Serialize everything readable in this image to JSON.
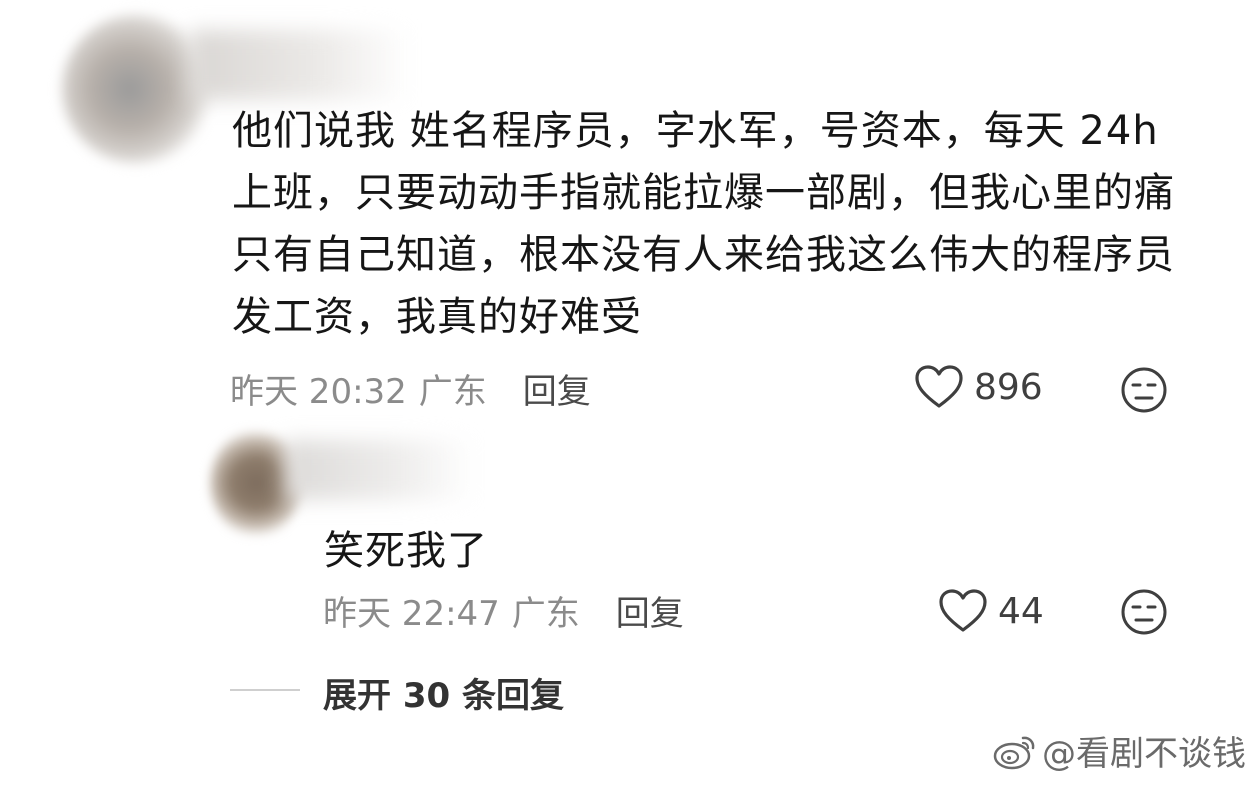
{
  "comment": {
    "text": "他们说我 姓名程序员，字水军，号资本，每天 24h\n上班，只要动动手指就能拉爆一部剧，但我心里的痛\n只有自己知道，根本没有人来给我这么伟大的程序员\n发工资，我真的好难受",
    "time": "昨天 20:32",
    "location": "广东",
    "reply_label": "回复",
    "like_count": "896"
  },
  "reply": {
    "text": "笑死我了",
    "time": "昨天 22:47",
    "location": "广东",
    "reply_label": "回复",
    "like_count": "44"
  },
  "expand": {
    "label": "展开 30 条回复"
  },
  "watermark": {
    "text": "@看剧不谈钱"
  },
  "icons": {
    "like": "heart-icon",
    "dislike": "meh-face-icon",
    "weibo": "weibo-logo-icon"
  }
}
